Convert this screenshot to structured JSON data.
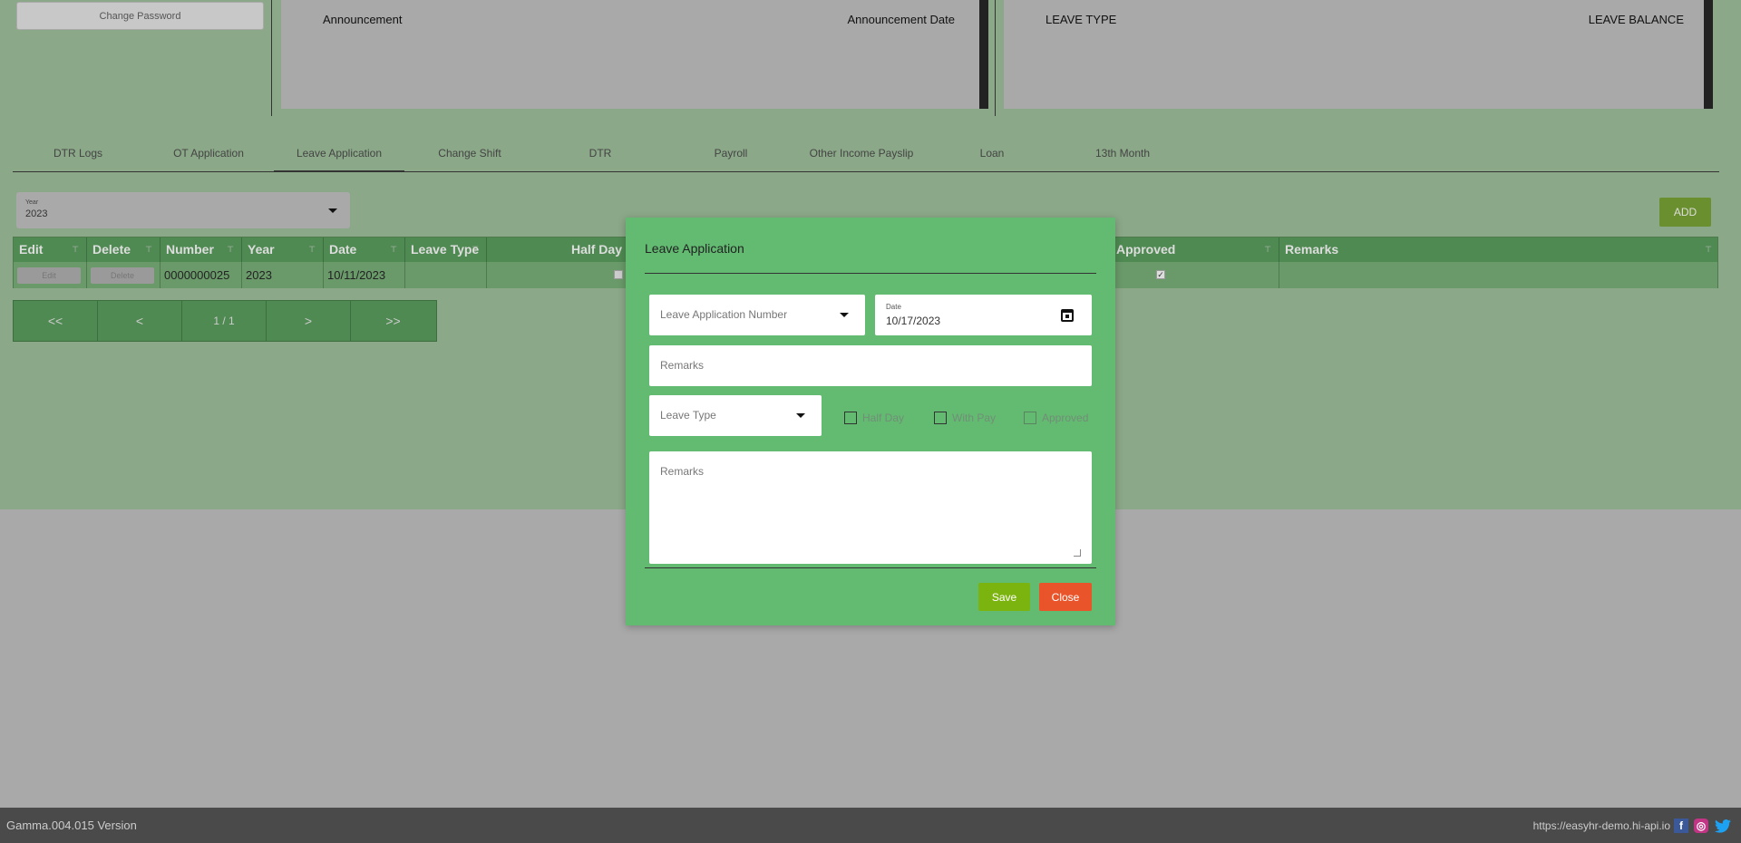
{
  "top": {
    "change_password": "Change Password",
    "announcement_col1": "Announcement",
    "announcement_col2": "Announcement Date",
    "leave_col1": "LEAVE TYPE",
    "leave_col2": "LEAVE BALANCE"
  },
  "tabs": [
    {
      "label": "DTR Logs"
    },
    {
      "label": "OT Application"
    },
    {
      "label": "Leave Application",
      "active": true
    },
    {
      "label": "Change Shift"
    },
    {
      "label": "DTR"
    },
    {
      "label": "Payroll"
    },
    {
      "label": "Other Income Payslip"
    },
    {
      "label": "Loan"
    },
    {
      "label": "13th Month"
    }
  ],
  "filter": {
    "year_label": "Year",
    "year_value": "2023"
  },
  "add_label": "ADD",
  "grid": {
    "headers": [
      "Edit",
      "Delete",
      "Number",
      "Year",
      "Date",
      "Leave Type",
      "Half Day",
      "Approved",
      "Remarks"
    ],
    "row": {
      "edit": "Edit",
      "delete": "Delete",
      "number": "0000000025",
      "year": "2023",
      "date": "10/11/2023",
      "leave_type": "",
      "half_day": false,
      "approved": true,
      "remarks": ""
    }
  },
  "pager": {
    "first": "<<",
    "prev": "<",
    "page": "1 / 1",
    "next": ">",
    "last": ">>"
  },
  "modal": {
    "title": "Leave Application",
    "leave_number_placeholder": "Leave Application Number",
    "date_label": "Date",
    "date_value": "10/17/2023",
    "remarks_placeholder": "Remarks",
    "leave_type_placeholder": "Leave Type",
    "half_day_label": "Half Day",
    "with_pay_label": "With Pay",
    "approved_label": "Approved",
    "remarks_area_placeholder": "Remarks",
    "save_label": "Save",
    "close_label": "Close"
  },
  "footer": {
    "version": "Gamma.004.015 Version",
    "url": "https://easyhr-demo.hi-api.io",
    "social_icons": [
      "facebook-icon",
      "instagram-icon",
      "twitter-icon"
    ]
  },
  "colors": {
    "page_green": "#8ba888",
    "modal_green": "#62bb71",
    "save": "#7cb40f",
    "close": "#e9542a",
    "footer": "#4a4a4a"
  }
}
